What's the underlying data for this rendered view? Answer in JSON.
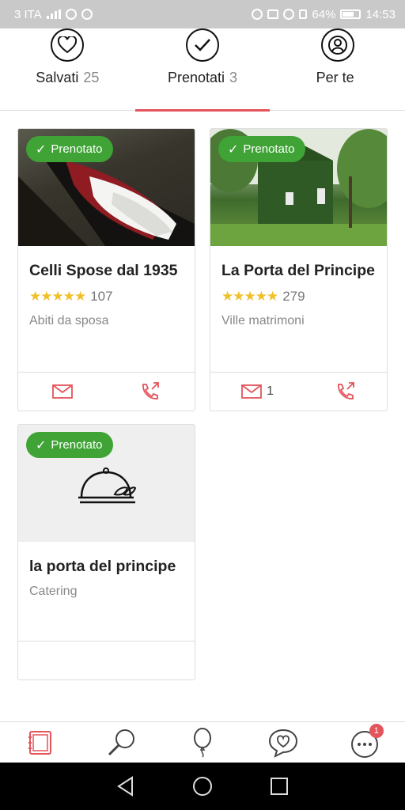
{
  "status_bar": {
    "carrier": "3 ITA",
    "battery": "64%",
    "time": "14:53"
  },
  "tabs": [
    {
      "label": "Salvati",
      "count": "25",
      "icon": "heart-icon"
    },
    {
      "label": "Prenotati",
      "count": "3",
      "icon": "check-circle-icon"
    },
    {
      "label": "Per te",
      "count": "",
      "icon": "person-target-icon"
    }
  ],
  "badge_label": "Prenotato",
  "cards": [
    {
      "title": "Celli Spose dal 1935",
      "rating_count": "107",
      "stars": "★★★★★",
      "category": "Abiti da sposa",
      "message_count": ""
    },
    {
      "title": "La Porta del Principe",
      "rating_count": "279",
      "stars": "★★★★★",
      "category": "Ville matrimoni",
      "message_count": "1"
    },
    {
      "title": "la porta del principe",
      "category": "Catering"
    }
  ],
  "bottom_nav": {
    "items": [
      "notebook-icon",
      "search-icon",
      "balloon-icon",
      "chat-heart-icon",
      "more-icon"
    ],
    "notification_count": "1"
  },
  "colors": {
    "accent": "#e4545b",
    "badge": "#3fa435",
    "stars": "#f0c02a"
  }
}
